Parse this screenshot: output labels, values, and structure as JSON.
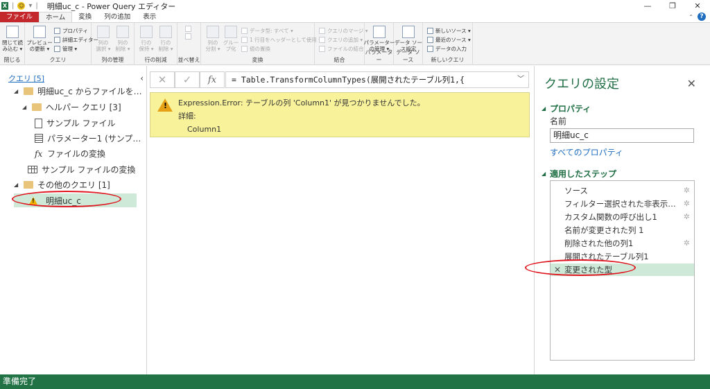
{
  "window": {
    "title": "明細uc_c - Power Query エディター",
    "controls": {
      "minimize": "—",
      "restore": "❐",
      "close": "✕"
    }
  },
  "ribbon_tabs": [
    "ファイル",
    "ホーム",
    "変換",
    "列の追加",
    "表示"
  ],
  "ribbon": {
    "groups": {
      "close": "閉じる",
      "query": "クエリ",
      "manage_columns": "列の管理",
      "reduce_rows": "行の削減",
      "sort": "並べ替え",
      "transform": "変換",
      "combine": "結合",
      "parameters": "パラメーター",
      "data_source": "データ ソース",
      "new_query": "新しいクエリ"
    },
    "buttons": {
      "close_load": "閉じて読\nみ込む ▾",
      "preview_refresh": "プレビュー\nの更新 ▾",
      "properties": "プロパティ",
      "advanced_editor": "詳細エディター",
      "manage": "管理 ▾",
      "choose_columns": "列の\n選択 ▾",
      "remove_columns": "列の\n削除 ▾",
      "keep_rows": "行の\n保持 ▾",
      "remove_rows": "行の\n削除 ▾",
      "split_column": "列の\n分割 ▾",
      "group_by": "グルー\nプ化",
      "data_type": "データ型: すべて ▾",
      "first_row_header": "1 行目をヘッダーとして使用 ▾",
      "replace_values": "値の置換",
      "merge_queries": "クエリのマージ ▾",
      "append_queries": "クエリの追加 ▾",
      "combine_files": "ファイルの結合",
      "manage_parameters": "パラメーター\nの管理 ▾",
      "data_source_settings": "データ ソー\nス設定",
      "new_source": "新しいソース ▾",
      "recent_sources": "最近のソース ▾",
      "enter_data": "データの入力"
    }
  },
  "queries_pane": {
    "title": "クエリ [5]",
    "collapse_icon": "‹",
    "tree": [
      {
        "label": "明細uc_c からファイルを…",
        "icon": "folder"
      },
      {
        "label": "ヘルパー クエリ [3]",
        "icon": "folder"
      },
      {
        "label": "サンプル ファイル",
        "icon": "document"
      },
      {
        "label": "パラメーター1 (サンプ…",
        "icon": "parameter"
      },
      {
        "label": "ファイルの変換",
        "icon": "fx"
      },
      {
        "label": "サンプル ファイルの変換",
        "icon": "table"
      },
      {
        "label": "その他のクエリ [1]",
        "icon": "folder"
      },
      {
        "label": "明細uc_c",
        "icon": "warning"
      }
    ]
  },
  "formula_bar": {
    "cancel": "✕",
    "commit": "✓",
    "fx": "fx",
    "expression": "= Table.TransformColumnTypes(展開されたテーブル列1,{"
  },
  "error": {
    "message": "Expression.Error: テーブルの列 'Column1' が見つかりませんでした。",
    "details_label": "詳細:",
    "details_value": "Column1"
  },
  "settings_pane": {
    "title": "クエリの設定",
    "close": "✕",
    "properties_header": "プロパティ",
    "name_label": "名前",
    "name_value": "明細uc_c",
    "all_properties_link": "すべてのプロパティ",
    "applied_steps_header": "適用したステップ",
    "steps": [
      {
        "label": "ソース",
        "gear": true
      },
      {
        "label": "フィルター選択された非表示…",
        "gear": true
      },
      {
        "label": "カスタム関数の呼び出し1",
        "gear": true
      },
      {
        "label": "名前が変更された列 1",
        "gear": false
      },
      {
        "label": "削除された他の列1",
        "gear": true
      },
      {
        "label": "展開されたテーブル列1",
        "gear": false
      },
      {
        "label": "変更された型",
        "gear": false,
        "selected": true
      }
    ]
  },
  "status_bar": {
    "text": "準備完了"
  },
  "colors": {
    "accent_green": "#217346",
    "highlight": "#cfe9d9",
    "error_bg": "#f8f29a",
    "annotation_red": "#e0141e"
  }
}
